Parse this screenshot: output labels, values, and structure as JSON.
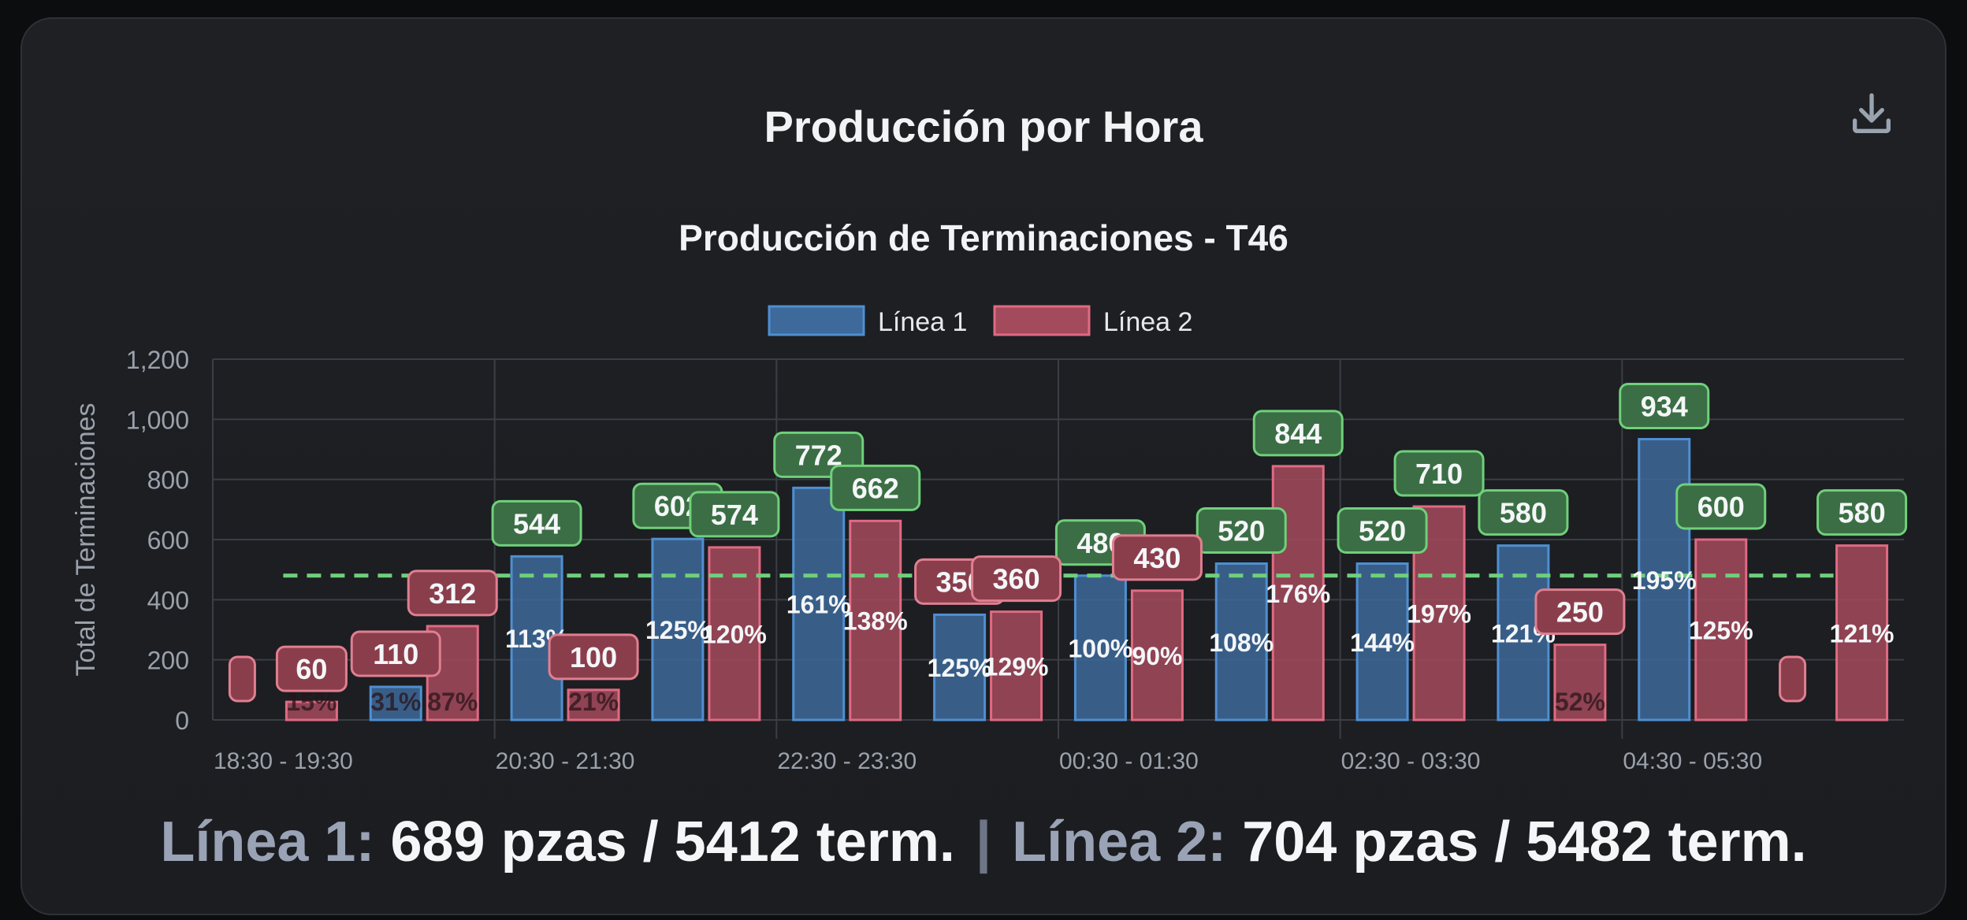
{
  "header": {
    "title": "Producción por Hora",
    "download_icon": "download-icon"
  },
  "colors": {
    "linea1_fill": "#3d6a9a",
    "linea1_stroke": "#4f8fd1",
    "linea2_fill": "#a34a5c",
    "linea2_stroke": "#e06a82",
    "target_line": "#6fd07a",
    "good_label_bg": "#3b6e44",
    "good_label_border": "#6fd07a",
    "low_label_bg": "#8a3e4c",
    "low_label_border": "#e07f90",
    "grid": "#3a3e45",
    "tick_text": "#9aa1ab"
  },
  "chart_data": {
    "type": "bar",
    "title": "Producción de Terminaciones - T46",
    "ylabel": "Total de Terminaciones",
    "xlabel": "",
    "ylim": [
      0,
      1200
    ],
    "yticks": [
      "0",
      "200",
      "400",
      "600",
      "800",
      "1,000",
      "1,200"
    ],
    "ytick_values": [
      0,
      200,
      400,
      600,
      800,
      1000,
      1200
    ],
    "grid": true,
    "legend_position": "top",
    "x_labels": [
      "18:30 - 19:30",
      "20:30 - 21:30",
      "22:30 - 23:30",
      "00:30 - 01:30",
      "02:30 - 03:30",
      "04:30 - 05:30"
    ],
    "target": 480,
    "series": [
      {
        "name": "Línea 1",
        "values": [
          0,
          110,
          544,
          602,
          772,
          350,
          480,
          520,
          520,
          580,
          934,
          0
        ],
        "value_labels": [
          "",
          "110",
          "544",
          "602",
          "772",
          "350",
          "480",
          "520",
          "520",
          "580",
          "934",
          ""
        ],
        "percent_labels": [
          "",
          "31%",
          "113%",
          "125%",
          "161%",
          "125%",
          "100%",
          "108%",
          "144%",
          "121%",
          "195%",
          ""
        ]
      },
      {
        "name": "Línea 2",
        "values": [
          60,
          312,
          100,
          574,
          662,
          360,
          430,
          844,
          710,
          250,
          600,
          580
        ],
        "value_labels": [
          "60",
          "312",
          "100",
          "574",
          "662",
          "360",
          "430",
          "844",
          "710",
          "250",
          "600",
          "580"
        ],
        "percent_labels": [
          "15%",
          "87%",
          "21%",
          "120%",
          "138%",
          "129%",
          "90%",
          "176%",
          "197%",
          "52%",
          "125%",
          "121%"
        ]
      }
    ]
  },
  "footer": {
    "linea1_label": "Línea 1:",
    "linea1_value": "689 pzas / 5412 term.",
    "separator": "|",
    "linea2_label": "Línea 2:",
    "linea2_value": "704 pzas / 5482 term."
  }
}
